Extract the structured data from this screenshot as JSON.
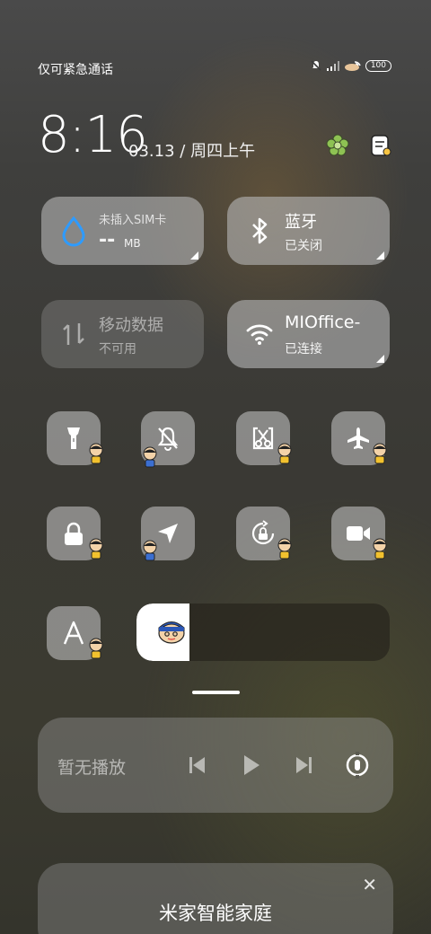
{
  "status_bar": {
    "carrier_text": "仅可紧急通话",
    "battery": "100"
  },
  "header": {
    "time": "8:16",
    "date": "03.13",
    "separator": "/",
    "weekday": "周四上午"
  },
  "tiles": {
    "data_usage": {
      "title": "未插入SIM卡",
      "value": "--",
      "unit": "MB"
    },
    "bluetooth": {
      "title": "蓝牙",
      "status": "已关闭"
    },
    "mobile_data": {
      "title": "移动数据",
      "status": "不可用"
    },
    "wifi": {
      "title": "MIOffice-",
      "status": "已连接"
    }
  },
  "buttons": [
    {
      "icon": "flashlight-icon"
    },
    {
      "icon": "silent-bell-icon"
    },
    {
      "icon": "screenshot-scissors-icon"
    },
    {
      "icon": "airplane-icon"
    },
    {
      "icon": "lock-icon"
    },
    {
      "icon": "location-arrow-icon"
    },
    {
      "icon": "auto-rotate-lock-icon"
    },
    {
      "icon": "video-camera-icon"
    },
    {
      "icon": "font-a-icon"
    }
  ],
  "brightness": {
    "level": 0.21
  },
  "media": {
    "text": "暂无播放"
  },
  "smart_home": {
    "title": "米家智能家庭",
    "close": "✕"
  },
  "colors": {
    "accent_blue": "#2e9bff",
    "tile_bg": "#b4b4b4"
  }
}
